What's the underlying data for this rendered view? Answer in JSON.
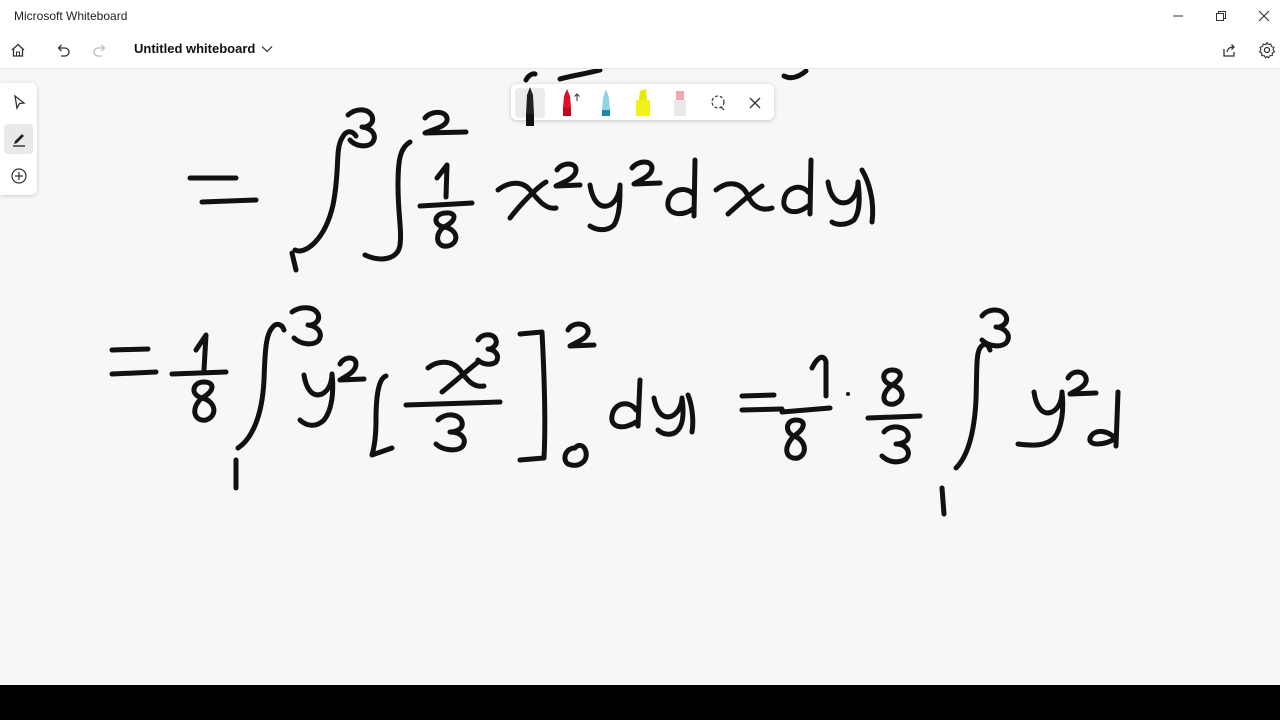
{
  "window": {
    "title": "Microsoft Whiteboard",
    "buttons": [
      "minimize-icon",
      "restore-icon",
      "close-icon"
    ]
  },
  "toolbar": {
    "board_title": "Untitled whiteboard",
    "left_icons": [
      "home-icon",
      "undo-icon",
      "redo-icon"
    ],
    "right_icons": [
      "share-icon",
      "settings-icon"
    ]
  },
  "left_tools": {
    "items": [
      "select-arrow-icon",
      "inking-pen-icon",
      "add-plus-icon"
    ],
    "active": "inking-pen-icon"
  },
  "pen_palette": {
    "pens": [
      {
        "icon": "black-pen-icon",
        "color": "#111111",
        "selected": true
      },
      {
        "icon": "red-pen-icon",
        "color": "#e0102a"
      },
      {
        "icon": "teal-pen-icon",
        "color": "#1e8aa8"
      },
      {
        "icon": "yellow-highlighter-icon",
        "color": "#f2f21a"
      },
      {
        "icon": "pink-highlighter-icon",
        "color": "#f1a7b4"
      }
    ],
    "lasso_icon": "lasso-icon",
    "close_icon": "close-icon"
  },
  "ink_color": "#111111",
  "canvas_background": "#f7f7f7"
}
